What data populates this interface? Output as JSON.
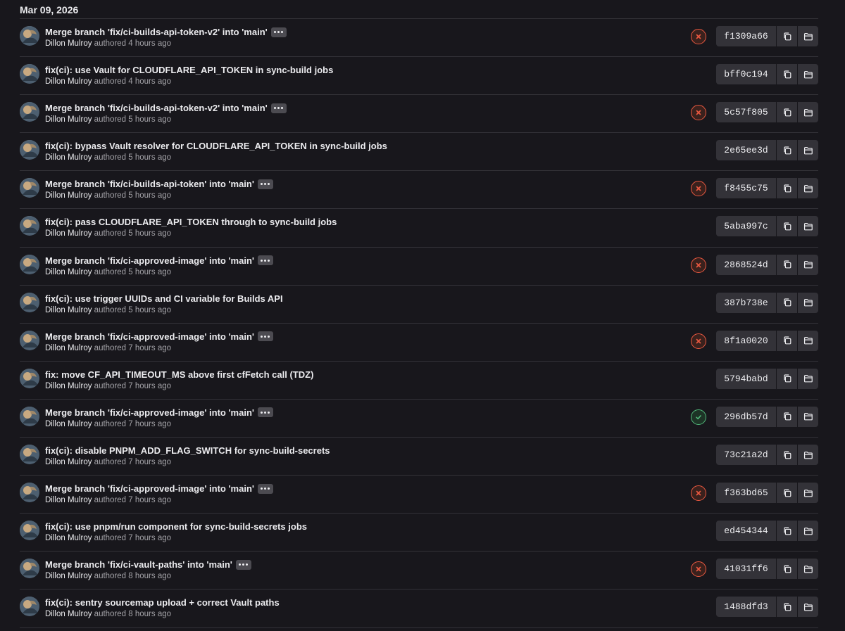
{
  "date_header": "Mar 09, 2026",
  "commits": [
    {
      "title": "Merge branch 'fix/ci-builds-api-token-v2' into 'main'",
      "has_ellipsis": true,
      "author": "Dillon Mulroy",
      "authored": "authored 4 hours ago",
      "status": "failed",
      "sha": "f1309a66"
    },
    {
      "title": "fix(ci): use Vault for CLOUDFLARE_API_TOKEN in sync-build jobs",
      "has_ellipsis": false,
      "author": "Dillon Mulroy",
      "authored": "authored 4 hours ago",
      "status": "",
      "sha": "bff0c194"
    },
    {
      "title": "Merge branch 'fix/ci-builds-api-token-v2' into 'main'",
      "has_ellipsis": true,
      "author": "Dillon Mulroy",
      "authored": "authored 5 hours ago",
      "status": "failed",
      "sha": "5c57f805"
    },
    {
      "title": "fix(ci): bypass Vault resolver for CLOUDFLARE_API_TOKEN in sync-build jobs",
      "has_ellipsis": false,
      "author": "Dillon Mulroy",
      "authored": "authored 5 hours ago",
      "status": "",
      "sha": "2e65ee3d"
    },
    {
      "title": "Merge branch 'fix/ci-builds-api-token' into 'main'",
      "has_ellipsis": true,
      "author": "Dillon Mulroy",
      "authored": "authored 5 hours ago",
      "status": "failed",
      "sha": "f8455c75"
    },
    {
      "title": "fix(ci): pass CLOUDFLARE_API_TOKEN through to sync-build jobs",
      "has_ellipsis": false,
      "author": "Dillon Mulroy",
      "authored": "authored 5 hours ago",
      "status": "",
      "sha": "5aba997c"
    },
    {
      "title": "Merge branch 'fix/ci-approved-image' into 'main'",
      "has_ellipsis": true,
      "author": "Dillon Mulroy",
      "authored": "authored 5 hours ago",
      "status": "failed",
      "sha": "2868524d"
    },
    {
      "title": "fix(ci): use trigger UUIDs and CI variable for Builds API",
      "has_ellipsis": false,
      "author": "Dillon Mulroy",
      "authored": "authored 5 hours ago",
      "status": "",
      "sha": "387b738e"
    },
    {
      "title": "Merge branch 'fix/ci-approved-image' into 'main'",
      "has_ellipsis": true,
      "author": "Dillon Mulroy",
      "authored": "authored 7 hours ago",
      "status": "failed",
      "sha": "8f1a0020"
    },
    {
      "title": "fix: move CF_API_TIMEOUT_MS above first cfFetch call (TDZ)",
      "has_ellipsis": false,
      "author": "Dillon Mulroy",
      "authored": "authored 7 hours ago",
      "status": "",
      "sha": "5794babd"
    },
    {
      "title": "Merge branch 'fix/ci-approved-image' into 'main'",
      "has_ellipsis": true,
      "author": "Dillon Mulroy",
      "authored": "authored 7 hours ago",
      "status": "success",
      "sha": "296db57d"
    },
    {
      "title": "fix(ci): disable PNPM_ADD_FLAG_SWITCH for sync-build-secrets",
      "has_ellipsis": false,
      "author": "Dillon Mulroy",
      "authored": "authored 7 hours ago",
      "status": "",
      "sha": "73c21a2d"
    },
    {
      "title": "Merge branch 'fix/ci-approved-image' into 'main'",
      "has_ellipsis": true,
      "author": "Dillon Mulroy",
      "authored": "authored 7 hours ago",
      "status": "failed",
      "sha": "f363bd65"
    },
    {
      "title": "fix(ci): use pnpm/run component for sync-build-secrets jobs",
      "has_ellipsis": false,
      "author": "Dillon Mulroy",
      "authored": "authored 7 hours ago",
      "status": "",
      "sha": "ed454344"
    },
    {
      "title": "Merge branch 'fix/ci-vault-paths' into 'main'",
      "has_ellipsis": true,
      "author": "Dillon Mulroy",
      "authored": "authored 8 hours ago",
      "status": "failed",
      "sha": "41031ff6"
    },
    {
      "title": "fix(ci): sentry sourcemap upload + correct Vault paths",
      "has_ellipsis": false,
      "author": "Dillon Mulroy",
      "authored": "authored 8 hours ago",
      "status": "",
      "sha": "1488dfd3"
    }
  ],
  "icons": {
    "copy": "copy-icon",
    "folder": "folder-icon",
    "failed": "status-failed-icon",
    "success": "status-success-icon"
  },
  "colors": {
    "background": "#18171c",
    "failed": "#ec5941",
    "success": "#52b87a",
    "sha_bg": "#333238"
  }
}
